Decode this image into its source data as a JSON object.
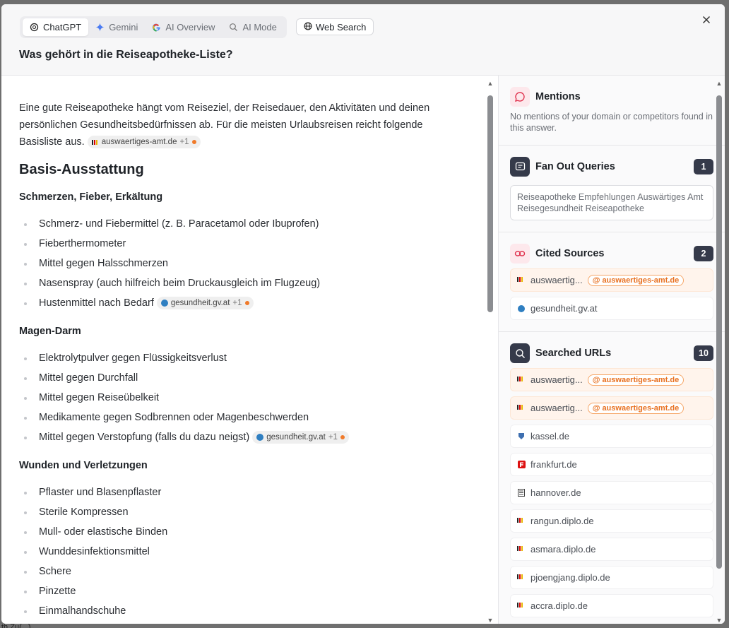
{
  "tabs": [
    {
      "label": "ChatGPT",
      "icon": "chatgpt-icon",
      "active": true
    },
    {
      "label": "Gemini",
      "icon": "gemini-icon",
      "active": false
    },
    {
      "label": "AI Overview",
      "icon": "google-icon",
      "active": false
    },
    {
      "label": "AI Mode",
      "icon": "ai-mode-icon",
      "active": false
    }
  ],
  "web_search_label": "Web Search",
  "question": "Was gehört in die Reiseapotheke-Liste?",
  "answer": {
    "intro": "Eine gute Reiseapotheke hängt vom Reiseziel, der Reisedauer, den Aktivitäten und deinen persönlichen Gesundheitsbedürfnissen ab. Für die meisten Urlaubsreisen reicht folgende Basisliste aus.",
    "intro_chip": {
      "domain": "auswaertiges-amt.de",
      "more": "+1"
    },
    "heading": "Basis-Ausstattung",
    "sections": [
      {
        "title": "Schmerzen, Fieber, Erkältung",
        "items": [
          "Schmerz- und Fiebermittel (z. B. Paracetamol oder Ibuprofen)",
          "Fieberthermometer",
          "Mittel gegen Halsschmerzen",
          "Nasenspray (auch hilfreich beim Druckausgleich im Flugzeug)",
          "Hustenmittel nach Bedarf"
        ],
        "chip": {
          "domain": "gesundheit.gv.at",
          "more": "+1"
        }
      },
      {
        "title": "Magen-Darm",
        "items": [
          "Elektrolytpulver gegen Flüssigkeitsverlust",
          "Mittel gegen Durchfall",
          "Mittel gegen Reiseübelkeit",
          "Medikamente gegen Sodbrennen oder Magenbeschwerden",
          "Mittel gegen Verstopfung (falls du dazu neigst)"
        ],
        "chip": {
          "domain": "gesundheit.gv.at",
          "more": "+1"
        }
      },
      {
        "title": "Wunden und Verletzungen",
        "items": [
          "Pflaster und Blasenpflaster",
          "Sterile Kompressen",
          "Mull- oder elastische Binden",
          "Wunddesinfektionsmittel",
          "Schere",
          "Pinzette",
          "Einmalhandschuhe"
        ]
      }
    ]
  },
  "sidebar": {
    "mentions": {
      "title": "Mentions",
      "text": "No mentions of your domain or competitors found in this answer."
    },
    "fan_out": {
      "title": "Fan Out Queries",
      "count": "1",
      "query": "Reiseapotheke Empfehlungen Auswärtiges Amt Reisegesundheit Reiseapotheke"
    },
    "cited": {
      "title": "Cited Sources",
      "count": "2",
      "items": [
        {
          "label": "auswaertig...",
          "badge": "auswaertiges-amt.de",
          "favicon": "de-flag-icon",
          "highlight": true
        },
        {
          "label": "gesundheit.gv.at",
          "badge": "",
          "favicon": "gv-icon",
          "highlight": false
        }
      ]
    },
    "searched": {
      "title": "Searched URLs",
      "count": "10",
      "items": [
        {
          "label": "auswaertig...",
          "badge": "auswaertiges-amt.de",
          "favicon": "de-flag-icon",
          "highlight": true
        },
        {
          "label": "auswaertig...",
          "badge": "auswaertiges-amt.de",
          "favicon": "de-flag-icon",
          "highlight": true
        },
        {
          "label": "kassel.de",
          "badge": "",
          "favicon": "kassel-icon",
          "highlight": false
        },
        {
          "label": "frankfurt.de",
          "badge": "",
          "favicon": "frankfurt-icon",
          "highlight": false
        },
        {
          "label": "hannover.de",
          "badge": "",
          "favicon": "hannover-icon",
          "highlight": false
        },
        {
          "label": "rangun.diplo.de",
          "badge": "",
          "favicon": "de-flag-icon",
          "highlight": false
        },
        {
          "label": "asmara.diplo.de",
          "badge": "",
          "favicon": "de-flag-icon",
          "highlight": false
        },
        {
          "label": "pjoengjang.diplo.de",
          "badge": "",
          "favicon": "de-flag-icon",
          "highlight": false
        },
        {
          "label": "accra.diplo.de",
          "badge": "",
          "favicon": "de-flag-icon",
          "highlight": false
        }
      ]
    }
  },
  "colors": {
    "accent_orange": "#e8701f",
    "dark_badge": "#353a4a",
    "pink_icon": "#e0334f"
  }
}
